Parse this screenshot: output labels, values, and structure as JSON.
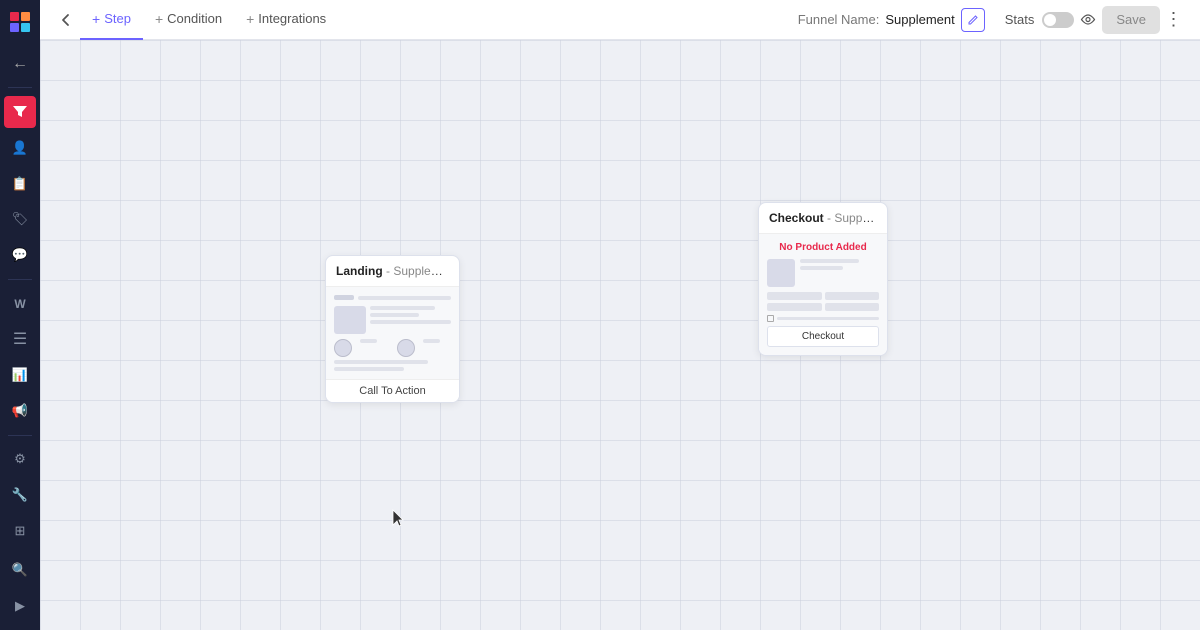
{
  "sidebar": {
    "logo": "▦",
    "icons": [
      {
        "name": "home-icon",
        "glyph": "⌂"
      },
      {
        "name": "funnel-icon",
        "glyph": "▤",
        "active": true
      },
      {
        "name": "contacts-icon",
        "glyph": "👥"
      },
      {
        "name": "pages-icon",
        "glyph": "📄"
      },
      {
        "name": "products-icon",
        "glyph": "🏷"
      },
      {
        "name": "feedback-icon",
        "glyph": "💬"
      },
      {
        "name": "wordpress-icon",
        "glyph": "W"
      },
      {
        "name": "automation-icon",
        "glyph": "≡"
      },
      {
        "name": "analytics-icon",
        "glyph": "📊"
      },
      {
        "name": "broadcast-icon",
        "glyph": "📢"
      },
      {
        "name": "settings-icon",
        "glyph": "⚙"
      },
      {
        "name": "tools-icon",
        "glyph": "🔧"
      },
      {
        "name": "integrations-icon",
        "glyph": "⊞"
      },
      {
        "name": "search-icon",
        "glyph": "🔍"
      },
      {
        "name": "play-icon",
        "glyph": "▶"
      }
    ]
  },
  "topbar": {
    "back_button": "←",
    "tabs": [
      {
        "label": "Step",
        "active": true,
        "plus": true
      },
      {
        "label": "Condition",
        "active": false,
        "plus": true
      },
      {
        "label": "Integrations",
        "active": false,
        "plus": true
      }
    ],
    "funnel_name_label": "Funnel Name:",
    "funnel_name_value": "Supplement",
    "edit_icon": "✏",
    "stats_label": "Stats",
    "save_label": "Save",
    "more_icon": "⋮"
  },
  "canvas": {
    "landing_card": {
      "title": "Landing",
      "subtitle": "- Supplement La...",
      "cta": "Call To Action"
    },
    "checkout_card": {
      "title": "Checkout",
      "subtitle": "- Supplement C...",
      "no_product": "No Product Added",
      "btn_label": "Checkout"
    }
  }
}
